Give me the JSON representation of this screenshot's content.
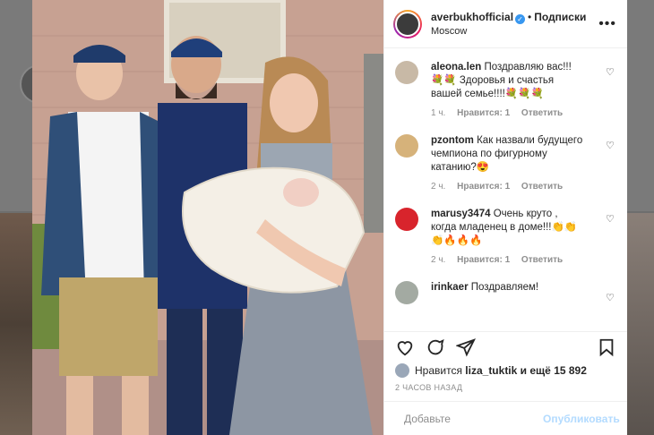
{
  "post": {
    "author": "averbukhofficial",
    "follow_label": "Подписки",
    "location": "Moscow",
    "more_icon": "more-horizontal-icon",
    "verified_icon": "verified-badge-icon"
  },
  "comments": [
    {
      "user": "aleona.len",
      "text": "Поздравляю вас!!! 💐💐 Здоровья и счастья вашей семье!!!!💐💐💐",
      "time": "1 ч.",
      "likes": "Нравится: 1",
      "reply": "Ответить",
      "avatar_color": "#c8b9a6"
    },
    {
      "user": "pzontom",
      "text": "Как назвали будущего чемпиона по фигурному катанию?😍",
      "time": "2 ч.",
      "likes": "Нравится: 1",
      "reply": "Ответить",
      "avatar_color": "#d6b27a"
    },
    {
      "user": "marusy3474",
      "text": "Очень круто , когда младенец в доме!!!👏👏👏🔥🔥🔥",
      "time": "2 ч.",
      "likes": "Нравится: 1",
      "reply": "Ответить",
      "avatar_color": "#d8242c"
    },
    {
      "user": "irinkaer",
      "text": "Поздравляем!",
      "time": "",
      "likes": "",
      "reply": "",
      "avatar_color": "#a3aaa2"
    }
  ],
  "likes_line": {
    "prefix": "Нравится",
    "user": "liza_tuktik",
    "suffix": "и ещё 15 892"
  },
  "timestamp": "2 ЧАСОВ НАЗАД",
  "add_comment": {
    "placeholder": "Добавьте",
    "publish": "Опубликовать"
  },
  "colors": {
    "accent": "#3897f0",
    "publish_disabled": "#b3dbff",
    "text": "#262626",
    "muted": "#8e8e8e"
  }
}
